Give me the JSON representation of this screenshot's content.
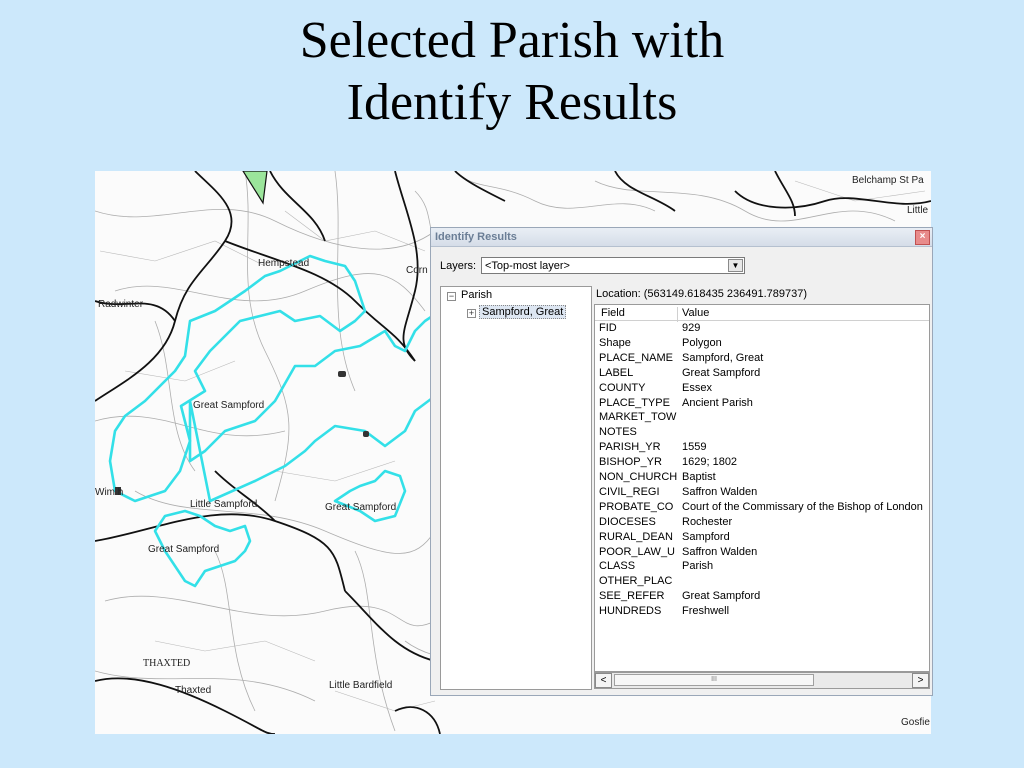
{
  "slide": {
    "title_line1": "Selected Parish with",
    "title_line2": "Identify Results"
  },
  "map": {
    "labels": {
      "hempstead": "Hempstead",
      "radwinter": "Radwinter",
      "great_sampford_1": "Great Sampford",
      "great_sampford_2": "Great Sampford",
      "great_sampford_3": "Great Sampford",
      "little_sampford": "Little Sampford",
      "wimbish": "Wim  h",
      "thaxted": "Thaxted",
      "thaxted_caps": "THAXTED",
      "little_bardfield": "Little Bardfield",
      "belchamp": "Belchamp St Pa",
      "little": "Little",
      "gosfield": "Gosfie",
      "corn": "Corn"
    },
    "colors": {
      "parish_outline": "#33e0e8",
      "boundary": "#111111",
      "accent_green": "#9be59b"
    }
  },
  "identify": {
    "window_title": "Identify Results",
    "close_glyph": "×",
    "layers_label": "Layers:",
    "layers_value": "<Top-most layer>",
    "dropdown_glyph": "▼",
    "tree": {
      "root_label": "Parish",
      "child_label": "Sampford, Great",
      "collapse_glyph": "−",
      "expand_glyph": "+"
    },
    "location": "Location: (563149.618435 236491.789737)",
    "columns": {
      "field": "Field",
      "value": "Value"
    },
    "rows": [
      {
        "field": "FID",
        "value": "929"
      },
      {
        "field": "Shape",
        "value": "Polygon"
      },
      {
        "field": "PLACE_NAME",
        "value": "Sampford, Great"
      },
      {
        "field": "LABEL",
        "value": "Great Sampford"
      },
      {
        "field": "COUNTY",
        "value": "Essex"
      },
      {
        "field": "PLACE_TYPE",
        "value": "Ancient Parish"
      },
      {
        "field": "MARKET_TOW",
        "value": ""
      },
      {
        "field": "NOTES",
        "value": ""
      },
      {
        "field": "PARISH_YR",
        "value": "1559"
      },
      {
        "field": "BISHOP_YR",
        "value": "1629; 1802"
      },
      {
        "field": "NON_CHURCH",
        "value": "Baptist"
      },
      {
        "field": "CIVIL_REGI",
        "value": "Saffron Walden"
      },
      {
        "field": "PROBATE_CO",
        "value": "Court of the Commissary of the Bishop of London"
      },
      {
        "field": "DIOCESES",
        "value": "Rochester"
      },
      {
        "field": "RURAL_DEAN",
        "value": "Sampford"
      },
      {
        "field": "POOR_LAW_U",
        "value": "Saffron Walden"
      },
      {
        "field": "CLASS",
        "value": "Parish"
      },
      {
        "field": "OTHER_PLAC",
        "value": ""
      },
      {
        "field": "SEE_REFER",
        "value": "Great Sampford"
      },
      {
        "field": "HUNDREDS",
        "value": "Freshwell"
      }
    ],
    "scroll": {
      "left_glyph": "<",
      "right_glyph": ">",
      "thumb_glyph": "III"
    }
  }
}
